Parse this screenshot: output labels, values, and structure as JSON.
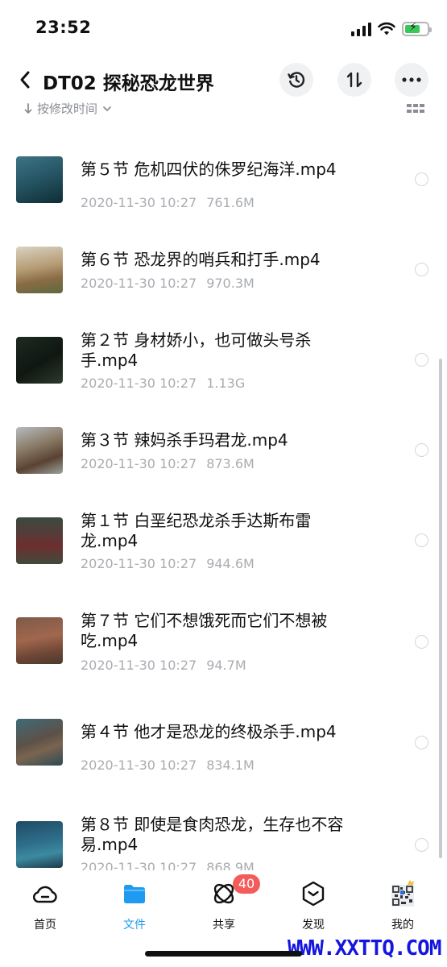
{
  "status_bar": {
    "time": "23:52"
  },
  "header": {
    "title": "DT02 探秘恐龙世界"
  },
  "sort": {
    "label": "按修改时间"
  },
  "files": [
    {
      "name": "第５节 危机四伏的侏罗纪海洋.mp4",
      "date": "2020-11-30 10:27",
      "size": "761.6M"
    },
    {
      "name": "第６节 恐龙界的哨兵和打手.mp4",
      "date": "2020-11-30 10:27",
      "size": "970.3M"
    },
    {
      "name": "第２节 身材娇小，也可做头号杀手.mp4",
      "date": "2020-11-30 10:27",
      "size": "1.13G"
    },
    {
      "name": "第３节 辣妈杀手玛君龙.mp4",
      "date": "2020-11-30 10:27",
      "size": "873.6M"
    },
    {
      "name": "第１节 白垩纪恐龙杀手达斯布雷龙.mp4",
      "date": "2020-11-30 10:27",
      "size": "944.6M"
    },
    {
      "name": "第７节 它们不想饿死而它们不想被吃.mp4",
      "date": "2020-11-30 10:27",
      "size": "94.7M"
    },
    {
      "name": "第４节 他才是恐龙的终极杀手.mp4",
      "date": "2020-11-30 10:27",
      "size": "834.1M"
    },
    {
      "name": "第８节 即使是食肉恐龙，生存也不容易.mp4",
      "date": "2020-11-30 10:27",
      "size": "868.9M"
    }
  ],
  "nav": {
    "home": "首页",
    "files": "文件",
    "share": "共享",
    "share_badge": "40",
    "discover": "发现",
    "mine": "我的"
  },
  "watermark": "WWW.XXTTQ.COM",
  "colors": {
    "accent": "#1e9bf0",
    "badge": "#f45b5b",
    "meta_text": "#a9acb1"
  }
}
